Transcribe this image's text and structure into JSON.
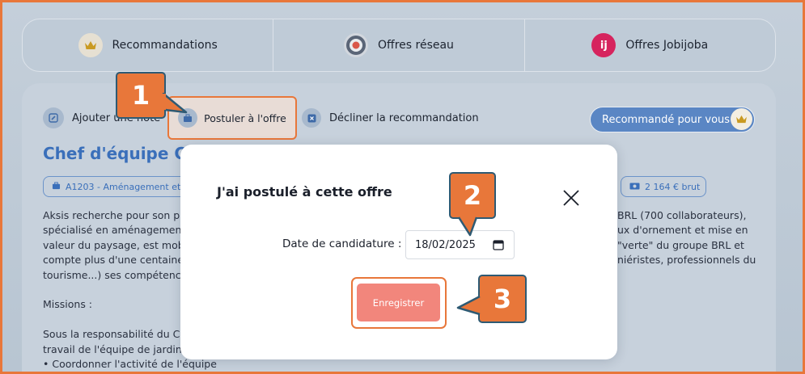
{
  "tabs": [
    {
      "label": "Recommandations",
      "icon": "crown-icon"
    },
    {
      "label": "Offres réseau",
      "icon": "target-icon"
    },
    {
      "label": "Offres Jobijoba",
      "icon": "jobijoba-icon",
      "icon_text": "ij"
    }
  ],
  "actions": {
    "add_note": "Ajouter une note",
    "apply": "Postuler à l'offre",
    "decline": "Décliner la recommandation",
    "recommended": "Recommandé pour vous"
  },
  "job": {
    "title": "Chef d'équipe Cré",
    "rome_pill": "A1203 - Aménagement et e",
    "salary_pill": "2 164 € brut",
    "desc_left": [
      "Aksis recherche pour son part",
      "spécialisé en aménagement r",
      "valeur du paysage, est mobilis",
      "compte plus d'une centaine d",
      "tourisme...) ses compétences",
      "",
      "Missions :",
      "",
      "Sous la responsabilité du Che",
      "travail de l'équipe de jardinier",
      "• Coordonner l'activité de l'équipe"
    ],
    "desc_right": [
      "BRL (700 collaborateurs),",
      "ux d'ornement et mise en",
      "\"verte\" du groupe BRL et",
      "niéristes, professionnels du"
    ]
  },
  "modal": {
    "title": "J'ai postulé à cette offre",
    "date_label": "Date de candidature :",
    "date_value": "18/02/2025",
    "save_label": "Enregistrer"
  },
  "callouts": {
    "one": "1",
    "two": "2",
    "three": "3"
  },
  "colors": {
    "accent": "#e8773a",
    "primary": "#3a6fba",
    "save": "#f2867c",
    "callout_border": "#2e5a73"
  }
}
